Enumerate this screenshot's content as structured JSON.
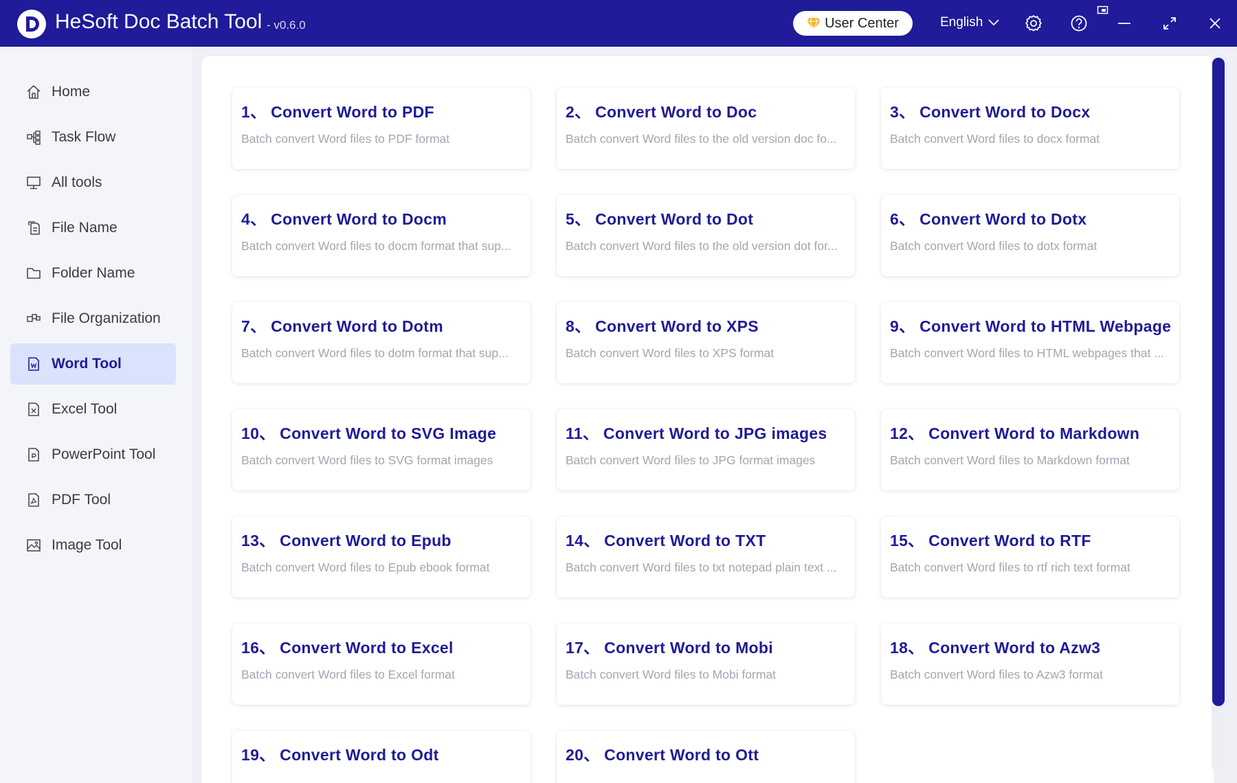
{
  "app": {
    "logo_letter": "D",
    "title": "HeSoft Doc Batch Tool",
    "version": "- v0.6.0"
  },
  "header": {
    "user_center_label": "User Center",
    "language_label": "English",
    "icons": [
      "gem-icon",
      "chevron-down-icon",
      "gear-icon",
      "help-icon",
      "pin-icon",
      "minimize-icon",
      "maximize-icon",
      "close-icon"
    ]
  },
  "sidebar": {
    "items": [
      {
        "label": "Home",
        "icon": "home-icon",
        "active": false
      },
      {
        "label": "Task Flow",
        "icon": "flow-icon",
        "active": false
      },
      {
        "label": "All tools",
        "icon": "monitor-icon",
        "active": false
      },
      {
        "label": "File Name",
        "icon": "file-copy-icon",
        "active": false
      },
      {
        "label": "Folder Name",
        "icon": "folder-icon",
        "active": false
      },
      {
        "label": "File Organization",
        "icon": "organize-icon",
        "active": false
      },
      {
        "label": "Word Tool",
        "icon": "word-file-icon",
        "active": true
      },
      {
        "label": "Excel Tool",
        "icon": "excel-file-icon",
        "active": false
      },
      {
        "label": "PowerPoint Tool",
        "icon": "powerpoint-file-icon",
        "active": false
      },
      {
        "label": "PDF Tool",
        "icon": "pdf-file-icon",
        "active": false
      },
      {
        "label": "Image Tool",
        "icon": "image-icon",
        "active": false
      }
    ]
  },
  "tools": [
    {
      "title": "1、 Convert Word to PDF",
      "desc": "Batch convert Word files to PDF format"
    },
    {
      "title": "2、 Convert Word to Doc",
      "desc": "Batch convert Word files to the old version doc fo..."
    },
    {
      "title": "3、 Convert Word to Docx",
      "desc": "Batch convert Word files to docx format"
    },
    {
      "title": "4、 Convert Word to Docm",
      "desc": "Batch convert Word files to docm format that sup..."
    },
    {
      "title": "5、 Convert Word to Dot",
      "desc": "Batch convert Word files to the old version dot for..."
    },
    {
      "title": "6、 Convert Word to Dotx",
      "desc": "Batch convert Word files to dotx format"
    },
    {
      "title": "7、 Convert Word to Dotm",
      "desc": "Batch convert Word files to dotm format that sup..."
    },
    {
      "title": "8、 Convert Word to XPS",
      "desc": "Batch convert Word files to XPS format"
    },
    {
      "title": "9、 Convert Word to HTML Webpage",
      "desc": "Batch convert Word files to HTML webpages that ..."
    },
    {
      "title": "10、 Convert Word to SVG Image",
      "desc": "Batch convert Word files to SVG format images"
    },
    {
      "title": "11、 Convert Word to JPG images",
      "desc": "Batch convert Word files to JPG format images"
    },
    {
      "title": "12、 Convert Word to Markdown",
      "desc": "Batch convert Word files to Markdown format"
    },
    {
      "title": "13、 Convert Word to Epub",
      "desc": "Batch convert Word files to Epub ebook format"
    },
    {
      "title": "14、 Convert Word to TXT",
      "desc": "Batch convert Word files to txt notepad plain text ..."
    },
    {
      "title": "15、 Convert Word to RTF",
      "desc": "Batch convert Word files to rtf rich text format"
    },
    {
      "title": "16、 Convert Word to Excel",
      "desc": "Batch convert Word files to Excel format"
    },
    {
      "title": "17、 Convert Word to Mobi",
      "desc": "Batch convert Word files to Mobi format"
    },
    {
      "title": "18、 Convert Word to Azw3",
      "desc": "Batch convert Word files to Azw3 format"
    },
    {
      "title": "19、 Convert Word to Odt",
      "desc": ""
    },
    {
      "title": "20、 Convert Word to Ott",
      "desc": ""
    }
  ],
  "colors": {
    "brand": "#1f1b99",
    "active_nav_bg": "#d9e3fb",
    "desc_text": "#a3a6b2",
    "gem": "#f5b319"
  }
}
